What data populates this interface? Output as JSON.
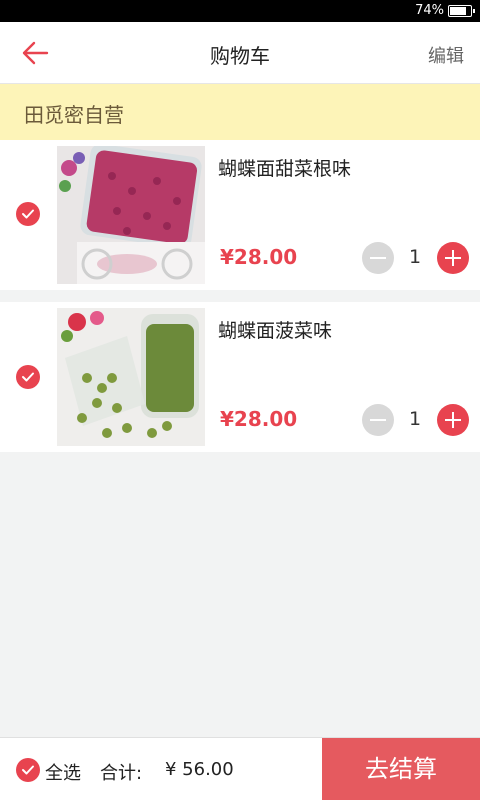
{
  "status_bar": {
    "battery_percent_label": "74%",
    "battery_level": 0.74
  },
  "nav": {
    "title": "购物车",
    "edit_label": "编辑"
  },
  "store": {
    "name": "田觅密自营"
  },
  "items": [
    {
      "name": "蝴蝶面甜菜根味",
      "price": "¥28.00",
      "quantity": "1",
      "checked": true,
      "image": "beetroot-pasta-jar"
    },
    {
      "name": "蝴蝶面菠菜味",
      "price": "¥28.00",
      "quantity": "1",
      "checked": true,
      "image": "spinach-pasta-jar"
    }
  ],
  "footer": {
    "select_all_label": "全选",
    "total_label": "合计:",
    "total_value": "¥ 56.00",
    "checkout_label": "去结算"
  },
  "colors": {
    "accent": "#e8434f",
    "checkout_bg": "#e55a5f",
    "store_bar": "#fdf4b8"
  }
}
